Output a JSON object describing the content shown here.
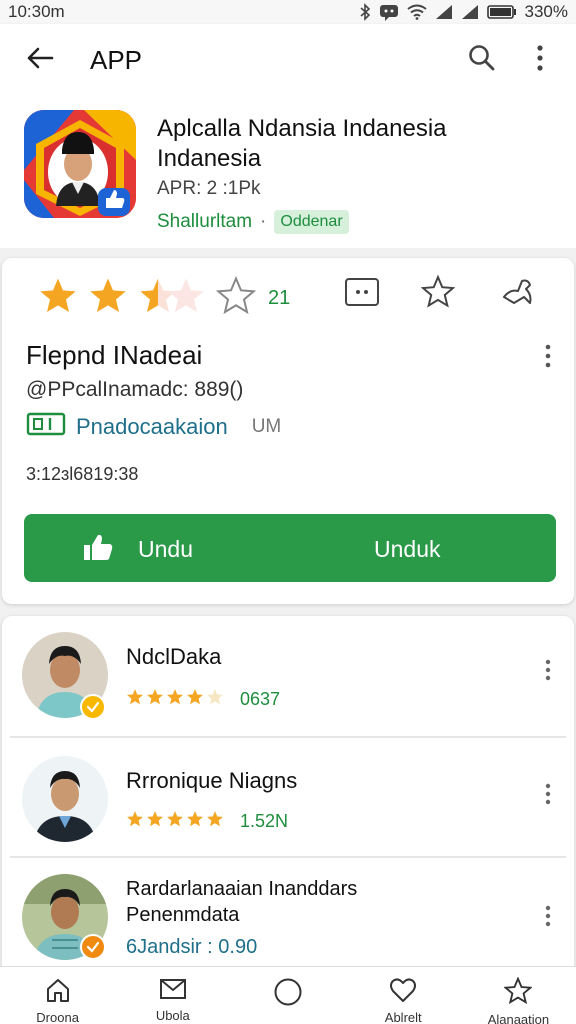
{
  "status_bar": {
    "time": "10:30m",
    "battery": "330%"
  },
  "app_bar": {
    "title": "APP"
  },
  "app": {
    "title": "Aplcalla Ndansia Indanesia Indanesia",
    "meta": "APR: 2 :1Pk",
    "developer": "Shallurltam",
    "separator": "·",
    "chip": "Oddenar"
  },
  "rating": {
    "filled": 2.5,
    "total": 5,
    "count": "21"
  },
  "review": {
    "title": "Flepnd INadeai",
    "handle": "@PPcalInamadc: 889()",
    "tag": "Pnadocaakaion",
    "tag_suffix": "UM",
    "timestamp": "3:12ɜl6819:38"
  },
  "download": {
    "left_label": "Undu",
    "right_label": "Unduk"
  },
  "users": [
    {
      "name": "NdclDaka",
      "stars": 4,
      "count": "0637",
      "badge_color": "#f9b800"
    },
    {
      "name": "Rrronique Niagns",
      "stars": 5,
      "count": "1.52N",
      "badge_color": ""
    },
    {
      "name": "Rardarlanaaian Inanddars\nPenenmdata",
      "stars": 0,
      "count": "6Jandsir : 0.90",
      "badge_color": "#f08a10"
    }
  ],
  "bottom_nav": [
    {
      "label": "Droona",
      "icon": "home-icon"
    },
    {
      "label": "Ubola",
      "icon": "mail-icon"
    },
    {
      "label": "",
      "icon": "circle-icon"
    },
    {
      "label": "Ablrelt",
      "icon": "heart-icon"
    },
    {
      "label": "Alanaation",
      "icon": "star-outline-icon"
    }
  ],
  "colors": {
    "accent": "#2a9a49",
    "star": "#f4a521",
    "link": "#1f6f8b"
  }
}
